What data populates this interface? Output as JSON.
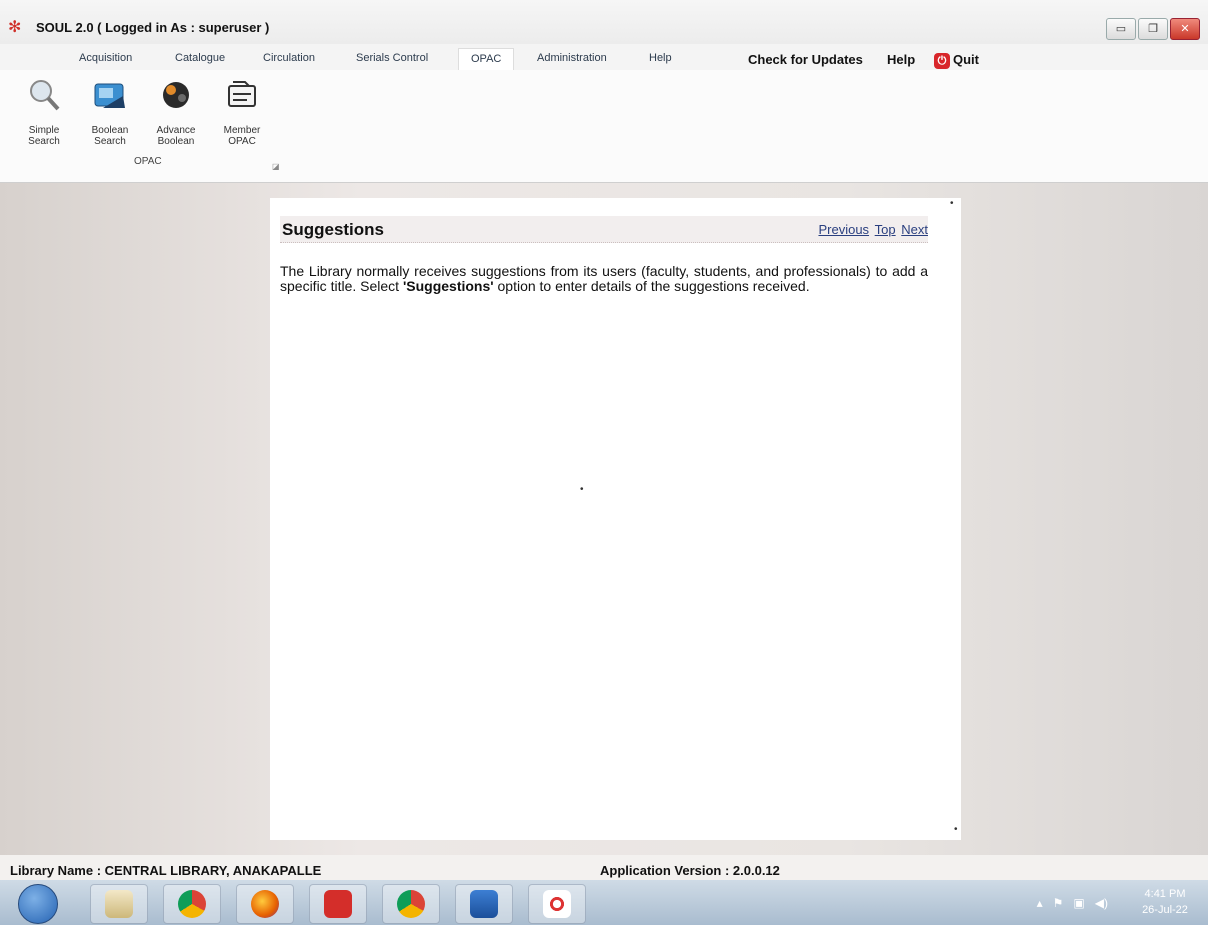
{
  "window": {
    "title": "SOUL 2.0  ( Logged in As : superuser )",
    "controls": [
      "minimize-icon",
      "maximize-icon",
      "close-icon"
    ]
  },
  "menu": {
    "tabs": [
      "Acquisition",
      "Catalogue",
      "Circulation",
      "Serials Control",
      "OPAC",
      "Administration",
      "Help"
    ],
    "active_tab": "OPAC",
    "check_updates": "Check for Updates",
    "help": "Help",
    "quit": "Quit"
  },
  "ribbon": {
    "buttons": [
      {
        "label": "Simple Search",
        "icon": "magnifier-icon"
      },
      {
        "label": "Boolean Search",
        "icon": "boolean-search-icon"
      },
      {
        "label": "Advance Boolean",
        "icon": "advance-boolean-icon"
      },
      {
        "label": "Member OPAC",
        "icon": "member-opac-icon"
      }
    ],
    "group_label": "OPAC"
  },
  "help_page": {
    "title": "Suggestions",
    "nav": {
      "previous": "Previous",
      "top": "Top",
      "next": "Next"
    },
    "body_before": "The Library normally receives suggestions from its users (faculty, students, and professionals) to add a specific title.  Select ",
    "body_bold": "'Suggestions'",
    "body_after": " option to enter details of the suggestions received."
  },
  "status": {
    "library_name": "Library Name : CENTRAL LIBRARY, ANAKAPALLE",
    "app_version": "Application Version : 2.0.0.12"
  },
  "taskbar": {
    "apps": [
      "file-explorer-icon",
      "chrome-icon",
      "firefox-icon",
      "pdf-reader-icon",
      "chrome-app-icon",
      "word-icon",
      "soul-app-icon"
    ],
    "time": "4:41 PM",
    "date": "26-Jul-22"
  },
  "colors": {
    "link": "#2a3f7f",
    "quit_red": "#d8262a",
    "taskbar": "#a9bccf"
  }
}
